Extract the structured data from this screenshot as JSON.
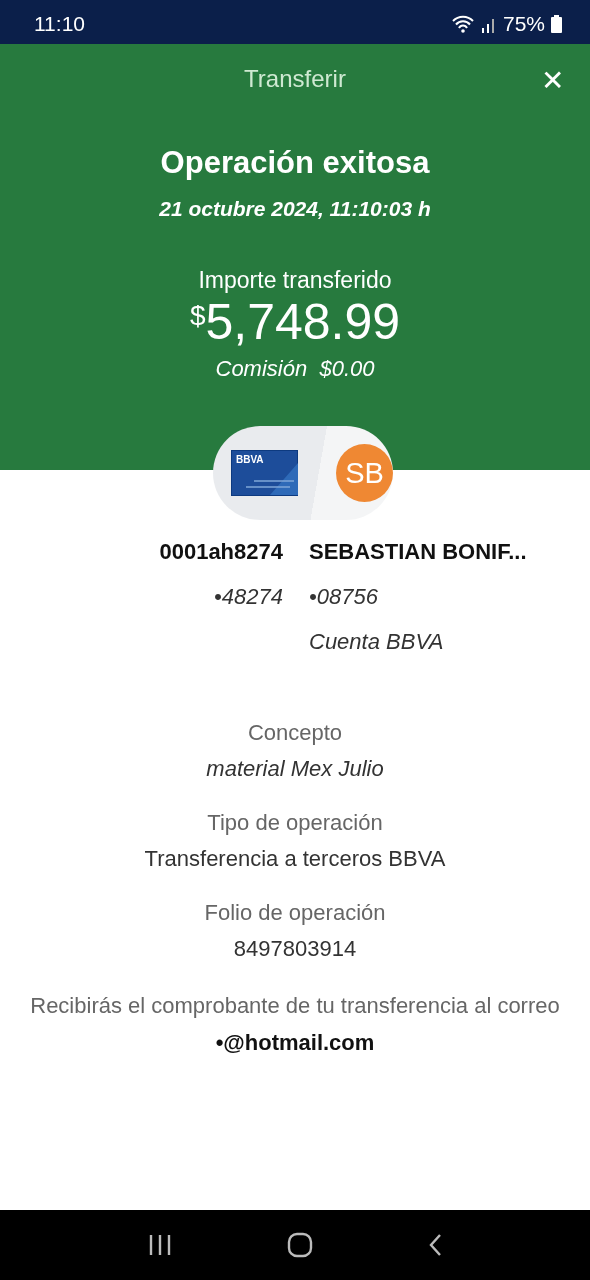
{
  "status_bar": {
    "time": "11:10",
    "battery": "75%"
  },
  "header": {
    "title": "Transferir",
    "close": "✕"
  },
  "result": {
    "title": "Operación exitosa",
    "datetime": "21 octubre 2024, 11:10:03 h",
    "amount_label": "Importe transferido",
    "currency": "$",
    "amount": "5,748.99",
    "commission": "Comisión  $0.00"
  },
  "origin": {
    "card_logo": "BBVA",
    "name": "0001ah8274",
    "account": "•48274"
  },
  "destination": {
    "initials": "SB",
    "name": "SEBASTIAN BONIF...",
    "account": "•08756",
    "bank": "Cuenta BBVA"
  },
  "details": [
    {
      "label": "Concepto",
      "value": "material Mex Julio",
      "kind": "italic"
    },
    {
      "label": "Tipo de operación",
      "value": "Transferencia a terceros BBVA",
      "kind": "plain"
    },
    {
      "label": "Folio de operación",
      "value": "8497803914",
      "kind": "plain"
    }
  ],
  "notice": {
    "text": "Recibirás el comprobante de tu transferencia al correo",
    "email": "•@hotmail.com"
  }
}
